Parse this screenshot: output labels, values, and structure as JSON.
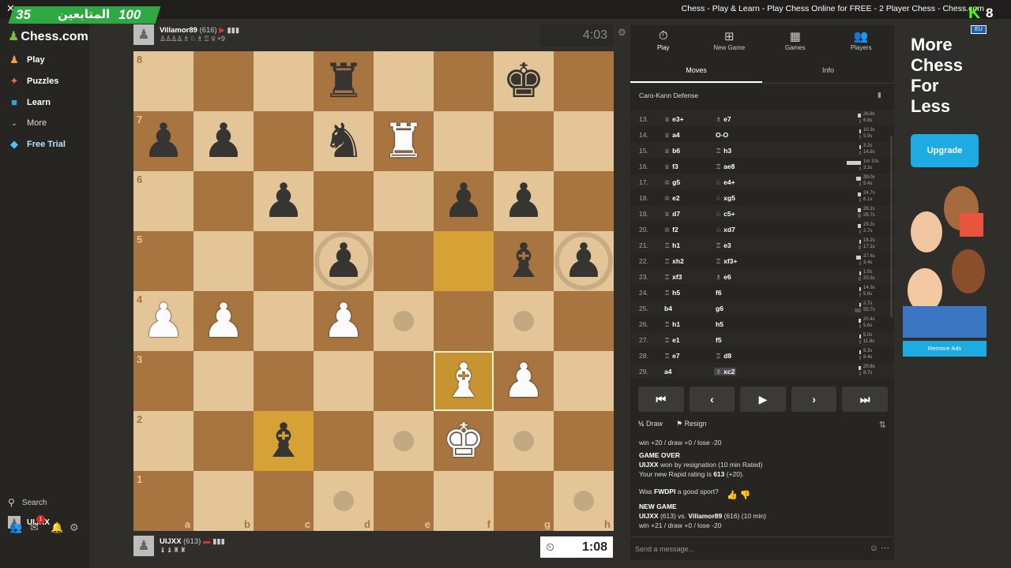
{
  "window": {
    "title": "Chess - Play & Learn - Play Chess Online for FREE - 2 Player Chess - Chess.com",
    "close_label": "✕"
  },
  "overlay": {
    "followers_count": "35",
    "followers_label": "المتابعين",
    "followers_goal": "100",
    "kick_logo": "K",
    "kick_number": "8",
    "flag_label": "EU"
  },
  "sidebar": {
    "logo": "Chess.com",
    "items": [
      {
        "label": "Play",
        "icon": "play-board-icon"
      },
      {
        "label": "Puzzles",
        "icon": "puzzle-icon"
      },
      {
        "label": "Learn",
        "icon": "learn-icon"
      },
      {
        "label": "More",
        "icon": "chevron-down-icon"
      },
      {
        "label": "Free Trial",
        "icon": "diamond-icon"
      }
    ],
    "search_label": "Search",
    "user_label": "UIJXX",
    "notification_count": "1"
  },
  "top_player": {
    "name": "Villamor89",
    "rating": "(616)",
    "captured": "♙♙♙♙ ♗ ♘ ♗ ♖ ♕",
    "material": "+9",
    "clock": "4:03"
  },
  "bottom_player": {
    "name": "UIJXX",
    "rating": "(613)",
    "captured": "♝ ♝ ♜ ♜",
    "clock": "1:08"
  },
  "board": {
    "files": [
      "a",
      "b",
      "c",
      "d",
      "e",
      "f",
      "g",
      "h"
    ],
    "ranks": [
      "8",
      "7",
      "6",
      "5",
      "4",
      "3",
      "2",
      "1"
    ],
    "pieces": [
      {
        "sq": "d8",
        "p": "♜",
        "c": "b"
      },
      {
        "sq": "g8",
        "p": "♚",
        "c": "b"
      },
      {
        "sq": "a7",
        "p": "♟",
        "c": "b"
      },
      {
        "sq": "b7",
        "p": "♟",
        "c": "b"
      },
      {
        "sq": "d7",
        "p": "♞",
        "c": "b"
      },
      {
        "sq": "e7",
        "p": "♜",
        "c": "w"
      },
      {
        "sq": "c6",
        "p": "♟",
        "c": "b"
      },
      {
        "sq": "f6",
        "p": "♟",
        "c": "b"
      },
      {
        "sq": "g6",
        "p": "♟",
        "c": "b"
      },
      {
        "sq": "d5",
        "p": "♟",
        "c": "b"
      },
      {
        "sq": "g5",
        "p": "♝",
        "c": "b"
      },
      {
        "sq": "h5",
        "p": "♟",
        "c": "b"
      },
      {
        "sq": "a4",
        "p": "♟",
        "c": "w"
      },
      {
        "sq": "b4",
        "p": "♟",
        "c": "w"
      },
      {
        "sq": "d4",
        "p": "♟",
        "c": "w"
      },
      {
        "sq": "f3",
        "p": "♝",
        "c": "w"
      },
      {
        "sq": "g3",
        "p": "♟",
        "c": "w"
      },
      {
        "sq": "c2",
        "p": "♝",
        "c": "b"
      },
      {
        "sq": "f2",
        "p": "♚",
        "c": "w"
      }
    ],
    "highlights": [
      "f5",
      "c2"
    ],
    "selected": "f3",
    "move_dots": [
      "e4",
      "g4",
      "e2",
      "g2",
      "d1",
      "h1"
    ],
    "capture_rings": [
      "d5",
      "h5"
    ]
  },
  "panel": {
    "tabs": [
      {
        "label": "Play",
        "icon": "stopwatch-icon"
      },
      {
        "label": "New Game",
        "icon": "plus-icon"
      },
      {
        "label": "Games",
        "icon": "grid-icon"
      },
      {
        "label": "Players",
        "icon": "players-icon"
      }
    ],
    "subtabs": [
      "Moves",
      "Info"
    ],
    "opening": "Caro-Kann Defense",
    "moves": [
      {
        "n": "13.",
        "w": "e3+",
        "wg": "♕",
        "b": "e7",
        "bg": "♗",
        "wt": "26.8s",
        "bt": "6.8s",
        "wb": 0.22,
        "bb": 0.06
      },
      {
        "n": "14.",
        "w": "a4",
        "wg": "♕",
        "b": "O-O",
        "bg": "",
        "wt": "10.3s",
        "bt": "5.9s",
        "wb": 0.09,
        "bb": 0.05
      },
      {
        "n": "15.",
        "w": "b6",
        "wg": "♕",
        "b": "h3",
        "bg": "♖",
        "wt": "3.2s",
        "bt": "14.8s",
        "wb": 0.03,
        "bb": 0.12
      },
      {
        "n": "16.",
        "w": "f3",
        "wg": "♕",
        "b": "ae8",
        "bg": "♖",
        "wt": "1m 10s",
        "bt": "3.3s",
        "wb": 1.0,
        "bb": 0.03
      },
      {
        "n": "17.",
        "w": "g5",
        "wg": "♔",
        "b": "e4+",
        "bg": "♘",
        "wt": "39.0s",
        "bt": "5.4s",
        "wb": 0.32,
        "bb": 0.05
      },
      {
        "n": "18.",
        "w": "e2",
        "wg": "♔",
        "b": "xg5",
        "bg": "♘",
        "wt": "24.7s",
        "bt": "6.1s",
        "wb": 0.2,
        "bb": 0.05
      },
      {
        "n": "19.",
        "w": "d7",
        "wg": "♕",
        "b": "c5+",
        "bg": "♘",
        "wt": "26.1s",
        "bt": "26.7s",
        "wb": 0.21,
        "bb": 0.22
      },
      {
        "n": "20.",
        "w": "f2",
        "wg": "♔",
        "b": "xd7",
        "bg": "♘",
        "wt": "29.3s",
        "bt": "2.7s",
        "wb": 0.24,
        "bb": 0.02
      },
      {
        "n": "21.",
        "w": "h1",
        "wg": "♖",
        "b": "e3",
        "bg": "♖",
        "wt": "16.2s",
        "bt": "17.1s",
        "wb": 0.13,
        "bb": 0.14
      },
      {
        "n": "22.",
        "w": "xh2",
        "wg": "♖",
        "b": "xf3+",
        "bg": "♖",
        "wt": "37.6s",
        "bt": "3.4s",
        "wb": 0.31,
        "bb": 0.03
      },
      {
        "n": "23.",
        "w": "xf3",
        "wg": "♖",
        "b": "e6",
        "bg": "♗",
        "wt": "1.0s",
        "bt": "20.3s",
        "wb": 0.01,
        "bb": 0.17
      },
      {
        "n": "24.",
        "w": "h5",
        "wg": "♖",
        "b": "f6",
        "bg": "",
        "wt": "14.3s",
        "bt": "5.6s",
        "wb": 0.12,
        "bb": 0.05
      },
      {
        "n": "25.",
        "w": "b4",
        "wg": "",
        "b": "g6",
        "bg": "",
        "wt": "2.7s",
        "bt": "55.7s",
        "wb": 0.02,
        "bb": 0.46
      },
      {
        "n": "26.",
        "w": "h1",
        "wg": "♖",
        "b": "h5",
        "bg": "",
        "wt": "20.4s",
        "bt": "5.6s",
        "wb": 0.17,
        "bb": 0.05
      },
      {
        "n": "27.",
        "w": "e1",
        "wg": "♖",
        "b": "f5",
        "bg": "",
        "wt": "5.0s",
        "bt": "11.8s",
        "wb": 0.04,
        "bb": 0.1
      },
      {
        "n": "28.",
        "w": "e7",
        "wg": "♖",
        "b": "d8",
        "bg": "♖",
        "wt": "9.3s",
        "bt": "8.4s",
        "wb": 0.08,
        "bb": 0.07
      },
      {
        "n": "29.",
        "w": "a4",
        "wg": "",
        "b": "xc2",
        "bg": "♗",
        "wt": "20.6s",
        "bt": "8.7s",
        "wb": 0.17,
        "bb": 0.07
      }
    ],
    "controls": [
      "⏮",
      "‹",
      "▶",
      "›",
      "⏭"
    ],
    "draw_label": "Draw",
    "resign_label": "Resign",
    "chat": {
      "line1": "win +20 / draw +0 / lose -20",
      "game_over": "GAME OVER",
      "result_user": "UIJXX",
      "result_text": " won by resignation (10 min Rated)",
      "rating_text": "Your new Rapid rating is ",
      "rating_value": "613",
      "rating_change": " (+20).",
      "sport_q1": "Was ",
      "sport_name": "FWDPI",
      "sport_q2": " a good sport?",
      "new_game": "NEW GAME",
      "ng_p1": "UIJXX",
      "ng_mid": " (613) vs. ",
      "ng_p2": "Villamor89",
      "ng_tail": " (616) (10 min)",
      "ng_line2": "win +21 / draw +0 / lose -20"
    },
    "message_placeholder": "Send a message..."
  },
  "ad": {
    "headline": "More\nChess\nFor\nLess",
    "button": "Upgrade",
    "remove": "Remove Ads"
  }
}
